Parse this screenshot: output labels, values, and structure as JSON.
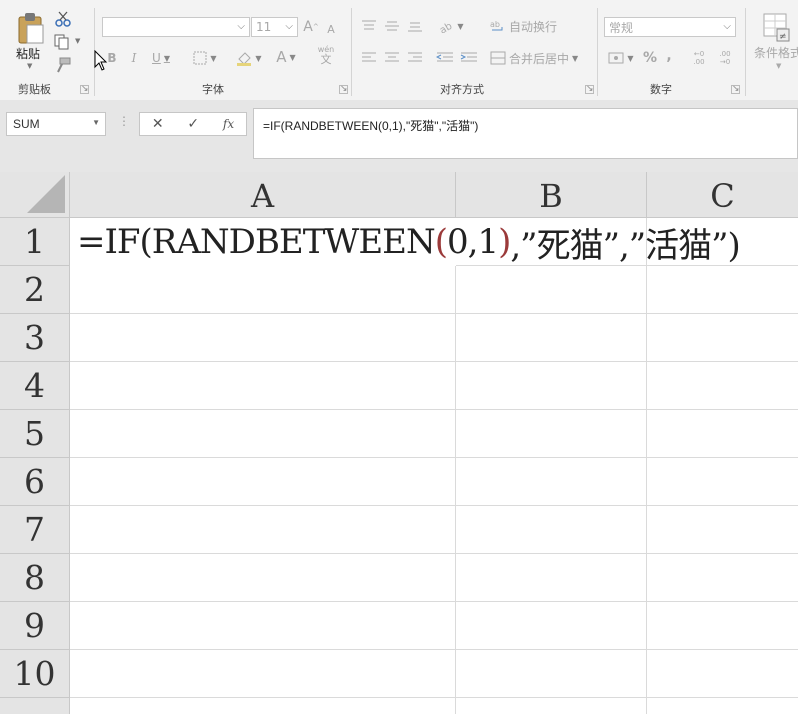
{
  "ribbon": {
    "clipboard": {
      "paste_label": "粘贴",
      "group_label": "剪贴板"
    },
    "font": {
      "font_name_value": "",
      "font_size_value": "11",
      "grow_font": "A",
      "shrink_font": "A",
      "bold": "B",
      "italic": "I",
      "underline": "U",
      "font_color": "A",
      "phonetic": "wén",
      "phonetic_char": "文",
      "group_label": "字体"
    },
    "alignment": {
      "wrap_text": "自动换行",
      "merge_center": "合并后居中",
      "group_label": "对齐方式"
    },
    "number": {
      "format_value": "常规",
      "percent": "%",
      "comma": ",",
      "increase_decimal": "←0 .00",
      "decrease_decimal": ".00 →0",
      "group_label": "数字"
    },
    "styles": {
      "conditional_format": "条件格式"
    }
  },
  "formula_bar": {
    "name_box": "SUM",
    "cancel": "✕",
    "enter": "✓",
    "fx": "fx",
    "formula": "=IF(RANDBETWEEN(0,1),\"死猫\",\"活猫\")"
  },
  "grid": {
    "columns": [
      "A",
      "B",
      "C"
    ],
    "rows": [
      "1",
      "2",
      "3",
      "4",
      "5",
      "6",
      "7",
      "8",
      "9",
      "10"
    ],
    "cell_a1_parts": {
      "head": "=IF(RANDBETWEEN",
      "open_paren": "(",
      "args": "0,1",
      "close_paren": ")",
      "tail": ",”死猫”,”活猫”)"
    }
  },
  "colors": {
    "ribbon_bg": "#f3f3f3",
    "header_bg": "#e4e4e4",
    "paren_highlight": "#9b3a3a"
  }
}
